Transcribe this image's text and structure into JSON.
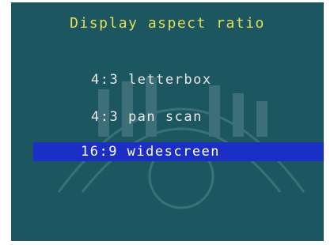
{
  "menu": {
    "title": "Display aspect ratio",
    "items": [
      {
        "label": "4:3 letterbox",
        "selected": false
      },
      {
        "label": "4:3 pan scan",
        "selected": false
      },
      {
        "label": "16:9 widescreen",
        "selected": true
      }
    ]
  },
  "colors": {
    "background": "#1c5660",
    "title": "#e6df5a",
    "item_text": "#e9e9e9",
    "highlight": "#1b2fc4"
  },
  "icons": {
    "watermark": "meridian-logo"
  }
}
